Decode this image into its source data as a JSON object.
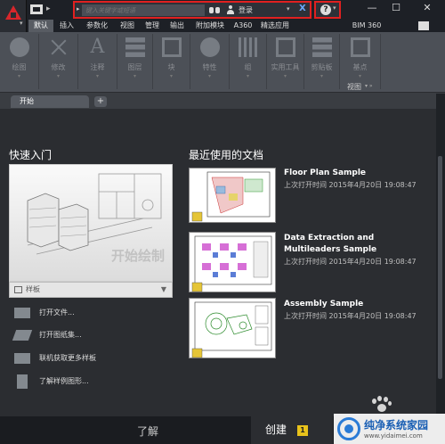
{
  "titlebar": {
    "search_placeholder": "键入关键字或短语",
    "user_label": "登录",
    "win_minimize": "—",
    "win_maximize": "☐",
    "win_close": "✕",
    "help_glyph": "?"
  },
  "ribbon_tabs": [
    "默认",
    "插入",
    "参数化",
    "视图",
    "管理",
    "输出",
    "附加模块",
    "A360",
    "精选应用",
    "BIM 360"
  ],
  "ribbon_groups": [
    {
      "label": "绘图",
      "icon": "circle-icon"
    },
    {
      "label": "修改",
      "icon": "cross-icon"
    },
    {
      "label": "注释",
      "icon": "letter-a-icon"
    },
    {
      "label": "图层",
      "icon": "layers-icon"
    },
    {
      "label": "块",
      "icon": "block-icon"
    },
    {
      "label": "特性",
      "icon": "properties-icon"
    },
    {
      "label": "组",
      "icon": "group-icon"
    },
    {
      "label": "实用工具",
      "icon": "utilities-icon"
    },
    {
      "label": "剪贴板",
      "icon": "clipboard-icon"
    },
    {
      "label": "基点",
      "icon": "base-icon"
    }
  ],
  "ribbon_view_label": "视图",
  "doc_tabs": {
    "start": "开始",
    "add": "+"
  },
  "quick_start": {
    "title": "快速入门",
    "start_drawing": "开始绘制",
    "template": "样板",
    "actions": [
      "打开文件...",
      "打开图纸集...",
      "联机获取更多样板",
      "了解样例图形..."
    ]
  },
  "recent": {
    "title": "最近使用的文档",
    "docs": [
      {
        "name": "Floor Plan Sample",
        "date": "上次打开时间 2015年4月20日 19:08:47"
      },
      {
        "name": "Data Extraction and Multileaders Sample",
        "date": "上次打开时间 2015年4月20日 19:08:47"
      },
      {
        "name": "Assembly Sample",
        "date": "上次打开时间 2015年4月20日 19:08:47"
      }
    ]
  },
  "bottom_tabs": {
    "learn": "了解",
    "create": "创建",
    "create_badge": "1"
  },
  "watermark": {
    "title": "纯净系统家园",
    "url": "www.yidaimei.com"
  },
  "colors": {
    "accent_red": "#e02020",
    "badge_yellow": "#e8c21b",
    "bg_dark": "#2b2d31"
  }
}
